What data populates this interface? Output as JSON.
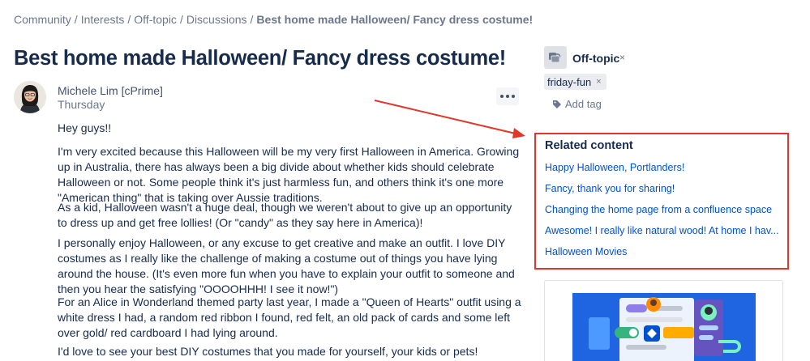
{
  "breadcrumb": {
    "items": [
      "Community",
      "Interests",
      "Off-topic",
      "Discussions"
    ],
    "current": "Best home made Halloween/ Fancy dress costume!"
  },
  "post": {
    "title": "Best home made Halloween/ Fancy dress costume!",
    "author": "Michele Lim [cPrime]",
    "date": "Thursday",
    "paragraphs": [
      "Hey guys!!",
      "I'm very excited because this Halloween will be my very first Halloween in America. Growing up in Australia, there has always been a big divide about whether kids should celebrate Halloween or not. Some people think it's just harmless fun, and others think it's one more \"American thing\" that is taking over Aussie traditions.",
      "As a kid, Halloween wasn't a huge deal, though we weren't about to give up an opportunity to dress up and get free lollies! (Or \"candy\" as they say here in America)!",
      "I personally enjoy Halloween, or any excuse to get creative and make an outfit. I love DIY costumes as I really like the challenge of making a costume out of things you have lying around the house. (It's even more fun when you have to explain your outfit to someone and then you hear the satisfying \"OOOOHHH! I see it now!\")",
      "For an Alice in Wonderland themed party last year, I made a \"Queen of Hearts\" outfit using a white dress I had, a random red ribbon I found, red felt, an old pack of cards and some left over gold/ red cardboard I had lying around.",
      "I'd love to see your best DIY costumes that you made for yourself, your kids or pets!"
    ]
  },
  "sidebar": {
    "space": "Off-topic",
    "tag": "friday-fun",
    "add_tag": "Add tag",
    "related_title": "Related content",
    "related": [
      "Happy Halloween, Portlanders!",
      "Fancy, thank you for sharing!",
      "Changing the home page from a confluence space",
      "Awesome! I really like natural wood! At home I hav...",
      "Halloween Movies"
    ]
  },
  "colors": {
    "accent_link": "#0052cc",
    "highlight_box": "#e0372b",
    "text": "#172b4d",
    "muted": "#6b778c"
  },
  "icons": {
    "space": "coffee-cup-icon",
    "add_tag": "tag-icon",
    "more": "more-dots-icon",
    "remove": "close-icon"
  }
}
